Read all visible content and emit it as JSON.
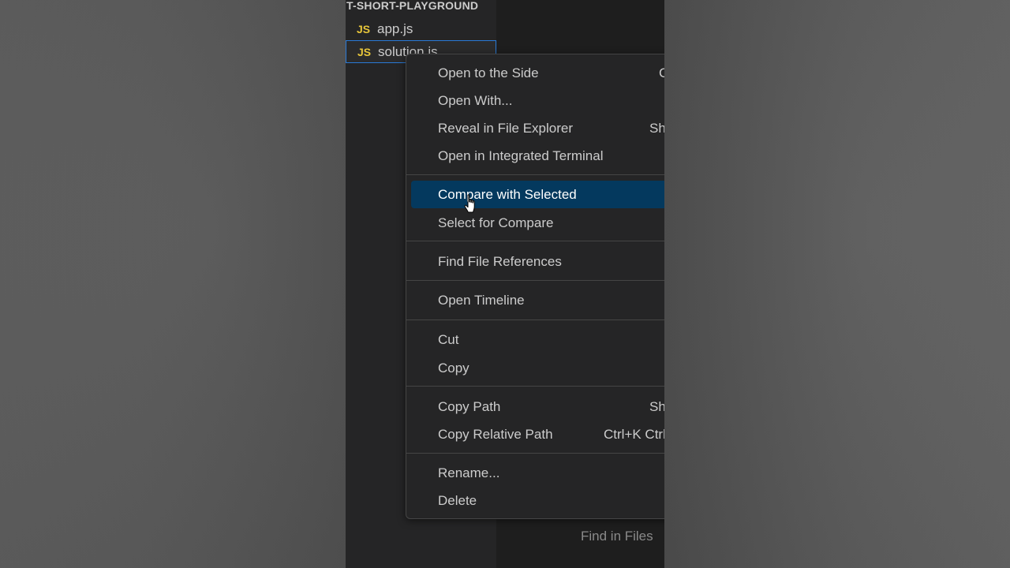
{
  "explorer": {
    "section_title": "T-SHORT-PLAYGROUND",
    "files": [
      {
        "icon": "JS",
        "name": "app.js"
      },
      {
        "icon": "JS",
        "name": "solution.js"
      }
    ]
  },
  "bottom_hint": "Find in Files",
  "context_menu": {
    "items": [
      {
        "label": "Open to the Side",
        "shortcut": "C"
      },
      {
        "label": "Open With..."
      },
      {
        "label": "Reveal in File Explorer",
        "shortcut": "Sh"
      },
      {
        "label": "Open in Integrated Terminal"
      },
      {
        "label": "Compare with Selected",
        "state": "hovered"
      },
      {
        "label": "Select for Compare"
      },
      {
        "label": "Find File References"
      },
      {
        "label": "Open Timeline"
      },
      {
        "label": "Cut"
      },
      {
        "label": "Copy"
      },
      {
        "label": "Copy Path",
        "shortcut": "Sh"
      },
      {
        "label": "Copy Relative Path",
        "shortcut": "Ctrl+K Ctrl"
      },
      {
        "label": "Rename..."
      },
      {
        "label": "Delete"
      }
    ]
  },
  "colors": {
    "menu_bg": "#252526",
    "highlight": "#04395e",
    "js_icon": "#e8c63a",
    "selection_border": "#2a7ad6"
  }
}
